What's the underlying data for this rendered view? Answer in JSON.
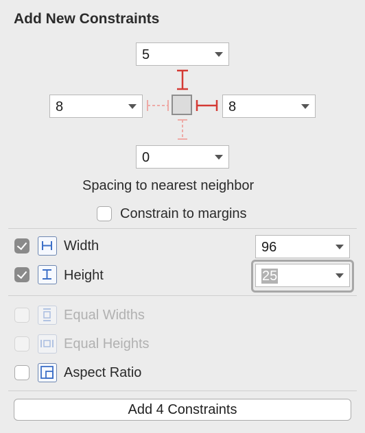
{
  "panel": {
    "title": "Add New Constraints"
  },
  "spacing": {
    "top": "5",
    "left": "8",
    "right": "8",
    "bottom": "0",
    "caption": "Spacing to nearest neighbor"
  },
  "margins": {
    "label": "Constrain to margins",
    "checked": false
  },
  "size": {
    "width": {
      "label": "Width",
      "value": "96",
      "checked": true
    },
    "height": {
      "label": "Height",
      "value": "25",
      "checked": true
    }
  },
  "equal": {
    "widths": {
      "label": "Equal Widths",
      "enabled": false
    },
    "heights": {
      "label": "Equal Heights",
      "enabled": false
    }
  },
  "aspect": {
    "label": "Aspect Ratio",
    "checked": false
  },
  "add_button": {
    "label": "Add 4 Constraints"
  },
  "colors": {
    "active_strut": "#d43a34",
    "inactive_strut": "#eeaaa6",
    "icon_blue": "#3c6fc7"
  }
}
